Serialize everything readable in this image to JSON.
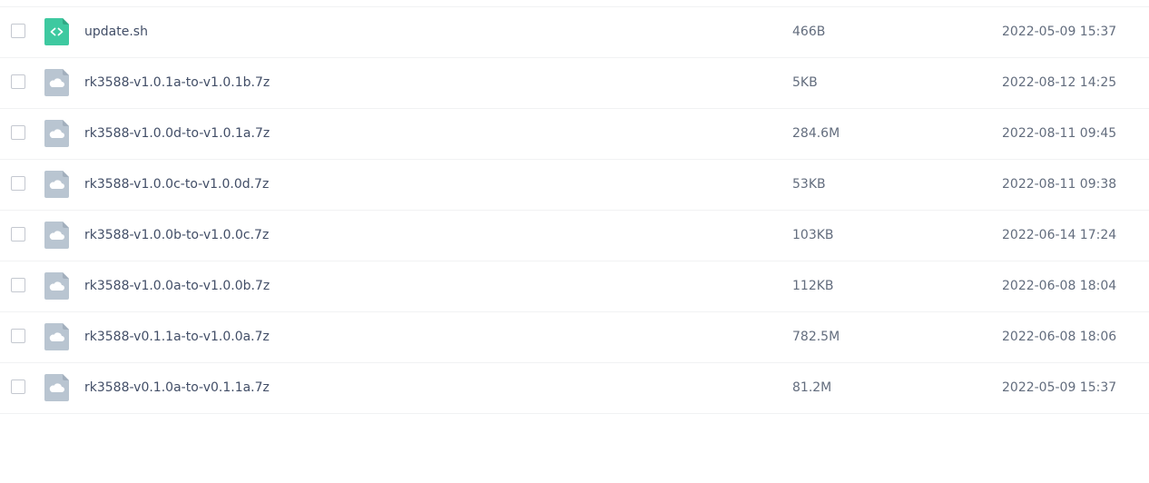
{
  "files": [
    {
      "name": "update.sh",
      "size": "466B",
      "date": "2022-05-09 15:37",
      "icon": "code-file-icon",
      "icon_color": "#3ec9a0"
    },
    {
      "name": "rk3588-v1.0.1a-to-v1.0.1b.7z",
      "size": "5KB",
      "date": "2022-08-12 14:25",
      "icon": "archive-file-icon",
      "icon_color": "#b9c5d1"
    },
    {
      "name": "rk3588-v1.0.0d-to-v1.0.1a.7z",
      "size": "284.6M",
      "date": "2022-08-11 09:45",
      "icon": "archive-file-icon",
      "icon_color": "#b9c5d1"
    },
    {
      "name": "rk3588-v1.0.0c-to-v1.0.0d.7z",
      "size": "53KB",
      "date": "2022-08-11 09:38",
      "icon": "archive-file-icon",
      "icon_color": "#b9c5d1"
    },
    {
      "name": "rk3588-v1.0.0b-to-v1.0.0c.7z",
      "size": "103KB",
      "date": "2022-06-14 17:24",
      "icon": "archive-file-icon",
      "icon_color": "#b9c5d1"
    },
    {
      "name": "rk3588-v1.0.0a-to-v1.0.0b.7z",
      "size": "112KB",
      "date": "2022-06-08 18:04",
      "icon": "archive-file-icon",
      "icon_color": "#b9c5d1"
    },
    {
      "name": "rk3588-v0.1.1a-to-v1.0.0a.7z",
      "size": "782.5M",
      "date": "2022-06-08 18:06",
      "icon": "archive-file-icon",
      "icon_color": "#b9c5d1"
    },
    {
      "name": "rk3588-v0.1.0a-to-v0.1.1a.7z",
      "size": "81.2M",
      "date": "2022-05-09 15:37",
      "icon": "archive-file-icon",
      "icon_color": "#b9c5d1"
    }
  ]
}
